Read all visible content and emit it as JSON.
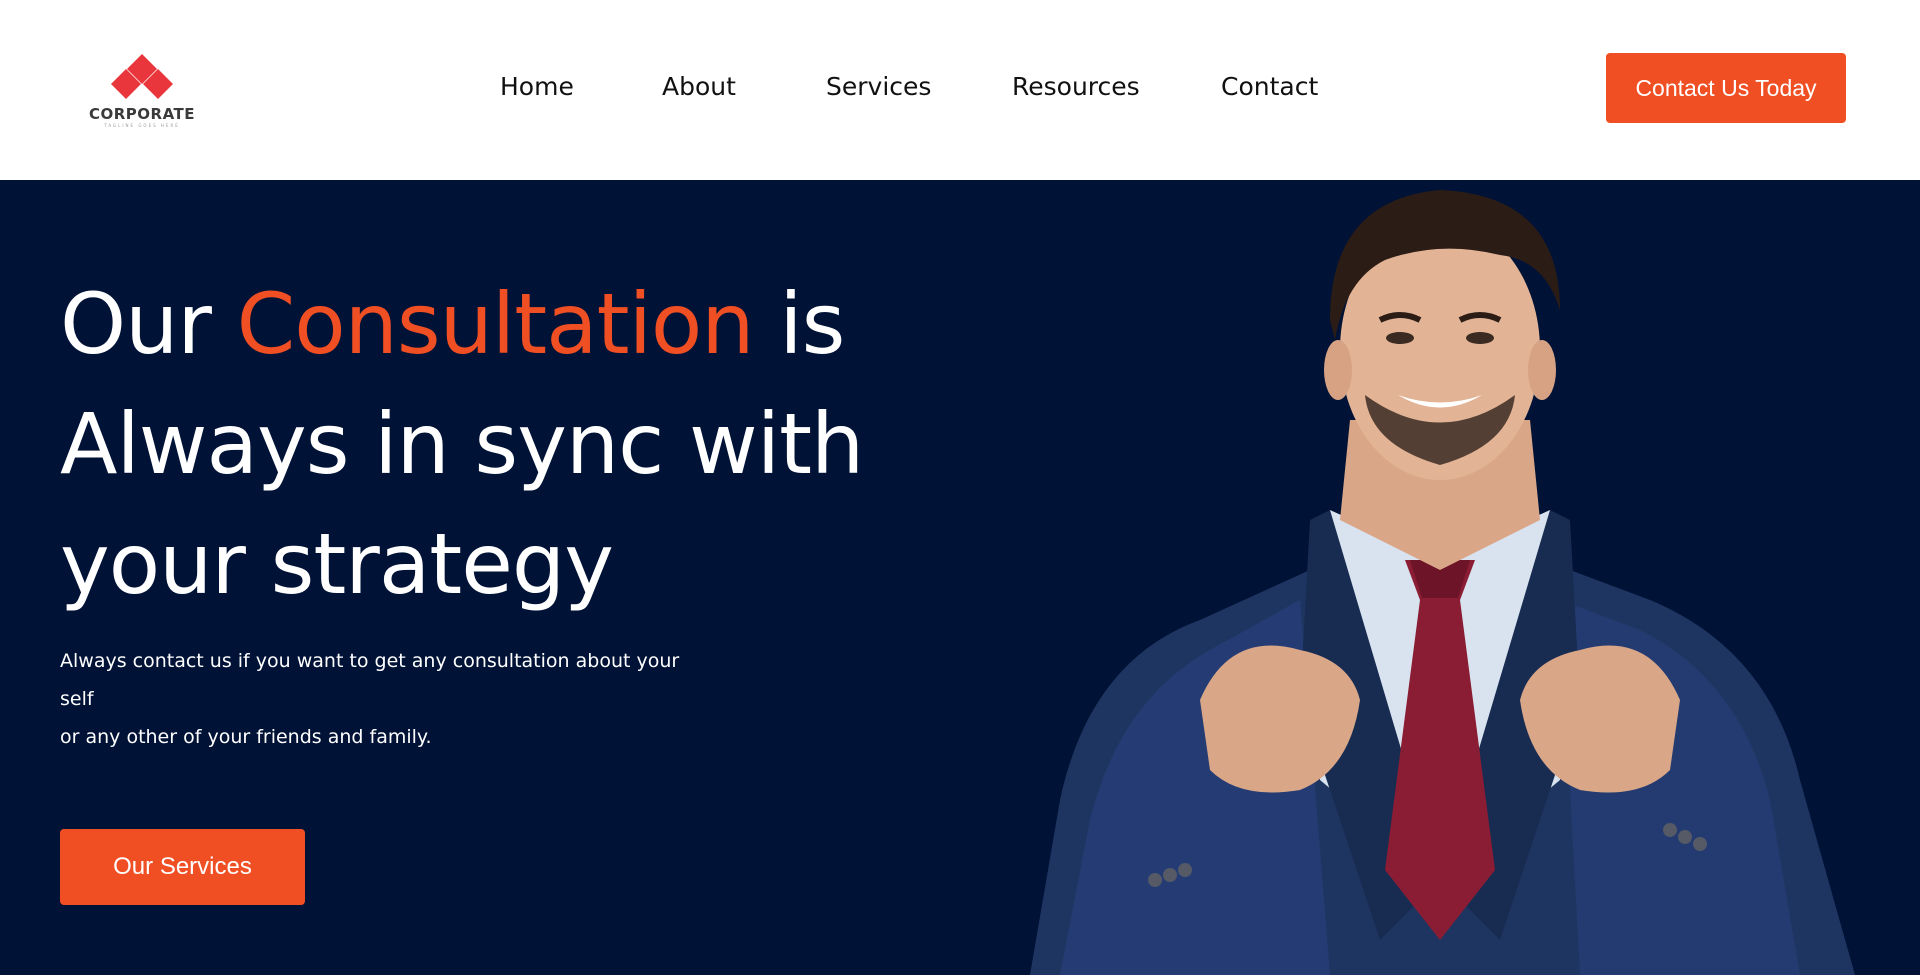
{
  "brand": {
    "name": "CORPORATE",
    "tagline": "TAGLINE GOES HERE",
    "colors": {
      "accent": "#f04e23",
      "hero_bg": "#001236",
      "logo_red": "#e8363c"
    }
  },
  "nav": {
    "items": [
      {
        "label": "Home"
      },
      {
        "label": "About"
      },
      {
        "label": "Services"
      },
      {
        "label": "Resources"
      },
      {
        "label": "Contact"
      }
    ]
  },
  "header": {
    "cta_label": "Contact Us Today"
  },
  "hero": {
    "title_part1": "Our ",
    "title_accent": "Consultation",
    "title_part2": " is Always in sync with your strategy",
    "description_line1": "Always contact us if you want to get any consultation about your self",
    "description_line2": "or any other of your friends and family.",
    "cta_label": "Our Services",
    "image": "smiling-businessman-adjusting-suit"
  }
}
